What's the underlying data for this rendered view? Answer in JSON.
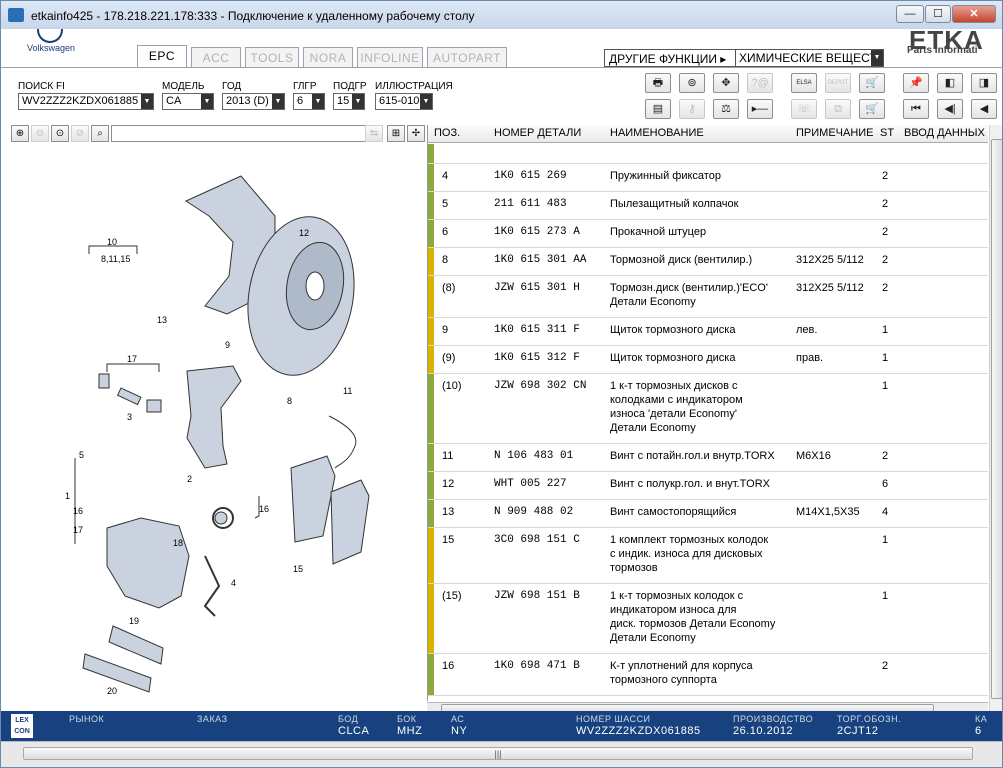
{
  "window": {
    "title": "etkainfo425 - 178.218.221.178:333 - Подключение к удаленному рабочему столу",
    "btn_min": "—",
    "btn_max": "☐",
    "btn_close": "✕"
  },
  "branding": {
    "vw_caption": "Volkswagen",
    "brand_name": "ETKA",
    "brand_sub": "Parts Informati"
  },
  "tabs": [
    {
      "label": "EPC"
    },
    {
      "label": "ACC"
    },
    {
      "label": "TOOLS"
    },
    {
      "label": "NORA"
    },
    {
      "label": "INFOLINE"
    },
    {
      "label": "AUTOPART"
    }
  ],
  "functions": {
    "label": "ДРУГИЕ ФУНКЦИИ ▸",
    "selected": "ХИМИЧЕСКИЕ ВЕЩЕСТВА"
  },
  "fields": {
    "search_fi": {
      "label": "ПОИСК FI",
      "value": "WV2ZZZ2KZDX061885"
    },
    "model": {
      "label": "МОДЕЛЬ",
      "value": "CA"
    },
    "year": {
      "label": "ГОД",
      "value": "2013 (D)"
    },
    "glgr": {
      "label": "ГЛГР",
      "value": "6"
    },
    "podgr": {
      "label": "ПОДГР",
      "value": "15"
    },
    "illustration": {
      "label": "ИЛЛЮСТРАЦИЯ",
      "value": "615-010"
    }
  },
  "toolbar_icons": [
    {
      "name": "print-icon",
      "glyph": "🖶"
    },
    {
      "name": "search-part-icon",
      "glyph": "⊚"
    },
    {
      "name": "handshake-icon",
      "glyph": "✥"
    },
    {
      "name": "help-disabled-icon",
      "glyph": "?@"
    },
    {
      "name": "elsa-icon",
      "glyph": "ELSA"
    },
    {
      "name": "depot-icon",
      "glyph": "DEPOT"
    },
    {
      "name": "cart-add-icon",
      "glyph": "🛒"
    },
    {
      "name": "pin-icon",
      "glyph": "📌"
    },
    {
      "name": "list-back-icon",
      "glyph": "◧"
    },
    {
      "name": "list-forward-icon",
      "glyph": "◨"
    },
    {
      "name": "table-icon",
      "glyph": "▤"
    },
    {
      "name": "key-icon",
      "glyph": "⚷"
    },
    {
      "name": "balance-icon",
      "glyph": "⚖"
    },
    {
      "name": "step-icon",
      "glyph": "▸—"
    },
    {
      "name": "phone-icon",
      "glyph": "☏"
    },
    {
      "name": "stack-icon",
      "glyph": "⧉"
    },
    {
      "name": "cart-icon",
      "glyph": "🛒"
    },
    {
      "name": "first-page-icon",
      "glyph": "⏮"
    },
    {
      "name": "prev-page-icon",
      "glyph": "◀|"
    },
    {
      "name": "prev-icon",
      "glyph": "◀"
    }
  ],
  "illustration_toolbar": [
    {
      "name": "zoom-in-icon",
      "glyph": "⊕"
    },
    {
      "name": "zoom-out-icon",
      "glyph": "⊖"
    },
    {
      "name": "zoom-fit-icon",
      "glyph": "⊙"
    },
    {
      "name": "zoom-select-icon",
      "glyph": "⊘"
    },
    {
      "name": "magnifier-icon",
      "glyph": "⌕"
    }
  ],
  "illustration_right_toolbar": [
    {
      "name": "link-icon",
      "glyph": "⇆"
    },
    {
      "name": "layout-icon",
      "glyph": "⊞"
    },
    {
      "name": "split-icon",
      "glyph": "✢"
    }
  ],
  "diagram_labels": [
    {
      "text": "10"
    },
    {
      "text": "8,11,15"
    },
    {
      "text": "12"
    },
    {
      "text": "13"
    },
    {
      "text": "9"
    },
    {
      "text": "17"
    },
    {
      "text": "3"
    },
    {
      "text": "2"
    },
    {
      "text": "8"
    },
    {
      "text": "11"
    },
    {
      "text": "5"
    },
    {
      "text": "1"
    },
    {
      "text": "16"
    },
    {
      "text": "17"
    },
    {
      "text": "16"
    },
    {
      "text": "18"
    },
    {
      "text": "4"
    },
    {
      "text": "15"
    },
    {
      "text": "19"
    },
    {
      "text": "20"
    }
  ],
  "grid": {
    "headers": {
      "pos": "ПОЗ.",
      "part_no": "НОМЕР ДЕТАЛИ",
      "name": "НАИМЕНОВАНИЕ",
      "note": "ПРИМЕЧАНИЕ",
      "st": "ST",
      "entry": "ВВОД ДАННЫХ"
    },
    "rows": [
      {
        "pos": "",
        "part": "",
        "name": "",
        "note": "",
        "st": "",
        "bar": "#8caa3c"
      },
      {
        "pos": "4",
        "part": "1K0  615  269",
        "name": "Пружинный фиксатор",
        "note": "",
        "st": "2",
        "bar": "#8caa3c"
      },
      {
        "pos": "5",
        "part": "211  611  483",
        "name": "Пылезащитный колпачок",
        "note": "",
        "st": "2",
        "bar": "#8caa3c"
      },
      {
        "pos": "6",
        "part": "1K0  615  273  A",
        "name": "Прокачной штуцер",
        "note": "",
        "st": "2",
        "bar": "#8caa3c"
      },
      {
        "pos": "8",
        "part": "1K0  615  301  AA",
        "name": "Тормозной диск (вентилир.)",
        "note": "312X25   5/112",
        "st": "2",
        "bar": "#d7b400"
      },
      {
        "pos": "(8)",
        "part": "JZW  615  301  H",
        "name": "Тормозн.диск (вентилир.)'ECO'\nДетали Economy",
        "note": "312X25   5/112",
        "st": "2",
        "bar": "#d7b400"
      },
      {
        "pos": "9",
        "part": "1K0  615  311  F",
        "name": "Щиток тормозного диска",
        "note": "лев.",
        "st": "1",
        "bar": "#d7b400"
      },
      {
        "pos": "(9)",
        "part": "1K0  615  312  F",
        "name": "Щиток тормозного диска",
        "note": "прав.",
        "st": "1",
        "bar": "#d7b400"
      },
      {
        "pos": "(10)",
        "part": "JZW  698  302  CN",
        "name": "1 к-т тормозных дисков с\nколодками с индикатором\nизноса       'детали Economy'\nДетали Economy",
        "note": "",
        "st": "1",
        "bar": "#8caa3c"
      },
      {
        "pos": "11",
        "part": "N     106  483  01",
        "name": "Винт с потайн.гол.и внутр.TORX",
        "note": "M6X16",
        "st": "2",
        "bar": "#8caa3c"
      },
      {
        "pos": "12",
        "part": "WHT  005  227",
        "name": "Винт с полукр.гол. и внут.TORX",
        "note": "",
        "st": "6",
        "bar": "#8caa3c"
      },
      {
        "pos": "13",
        "part": "N     909  488  02",
        "name": "Винт самостопорящийся",
        "note": "M14X1,5X35",
        "st": "4",
        "bar": "#8caa3c"
      },
      {
        "pos": "15",
        "part": "3C0  698  151  C",
        "name": "1 комплект тормозных колодок\nс индик. износа для дисковых\nтормозов",
        "note": "",
        "st": "1",
        "bar": "#d7b400"
      },
      {
        "pos": "(15)",
        "part": "JZW  698  151  B",
        "name": "1 к-т тормозных колодок с\nиндикатором износа для\nдиск. тормозов Детали Economy\nДетали Economy",
        "note": "",
        "st": "1",
        "bar": "#d7b400"
      },
      {
        "pos": "16",
        "part": "1K0  698  471  B",
        "name": "К-т уплотнений для корпуса\nтормозного суппорта",
        "note": "",
        "st": "2",
        "bar": "#8caa3c"
      }
    ]
  },
  "status": {
    "logo": "LEX\nCON",
    "market_label": "РЫНОК",
    "market_value": "",
    "order_label": "ЗАКАЗ",
    "order_value": "",
    "bod_label": "БОД",
    "bod_value": "CLCA",
    "box_label": "БОК",
    "box_value": "MHZ",
    "as_label": "АС",
    "as_value": "NY",
    "chassis_label": "НОМЕР ШАССИ",
    "chassis_value": "WV2ZZZ2KZDX061885",
    "prod_label": "ПРОИЗВОДСТВО",
    "prod_value": "26.10.2012",
    "torg_label": "ТОРГ.ОБОЗН.",
    "torg_value": "2CJT12",
    "ka_label": "КА",
    "ka_value": "6"
  },
  "bottom": {
    "grip": "|||"
  }
}
